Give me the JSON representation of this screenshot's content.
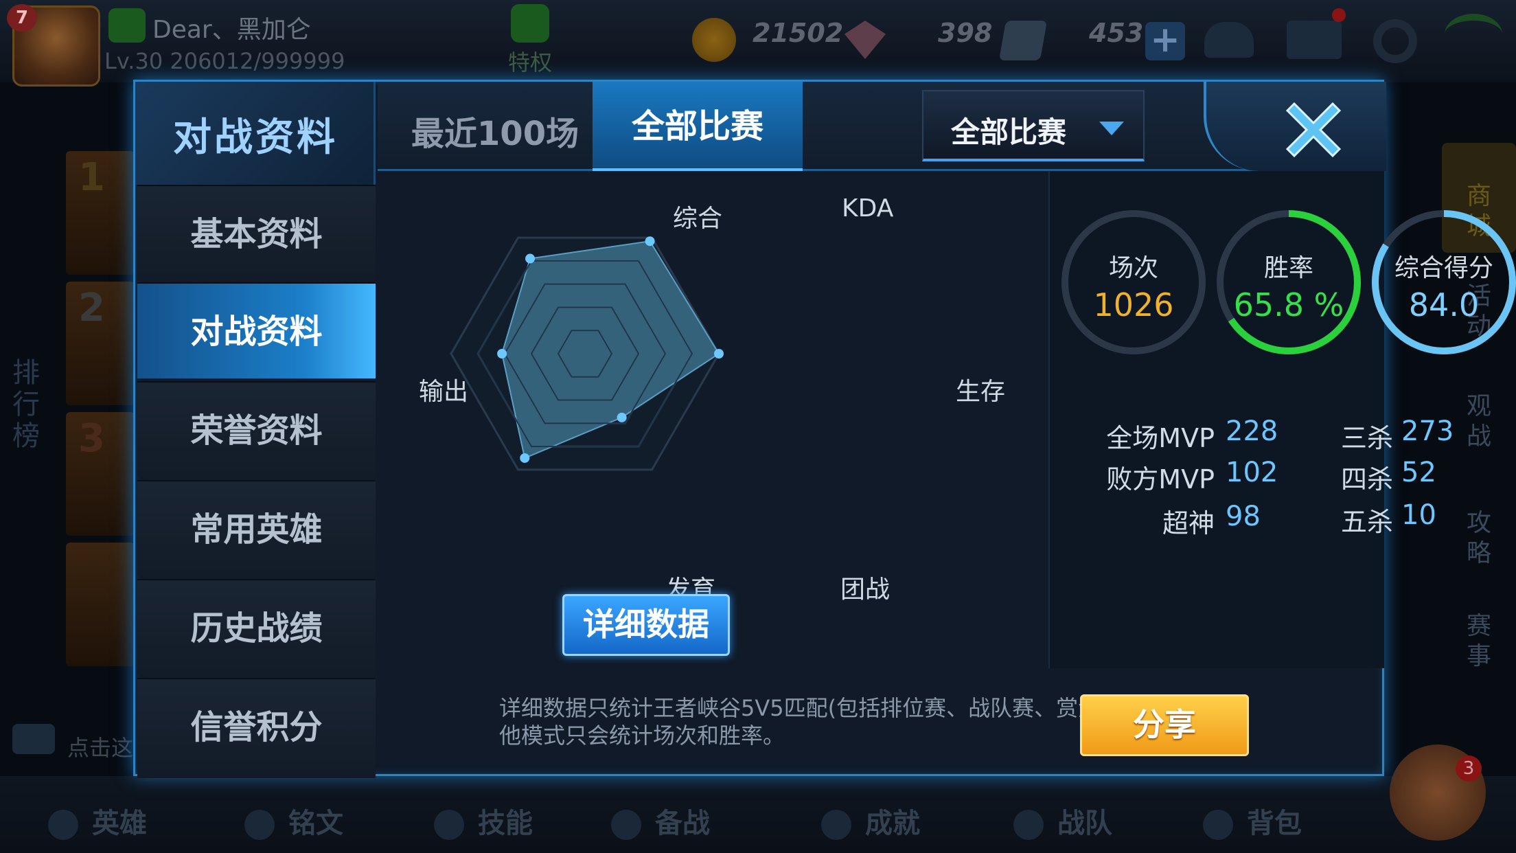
{
  "header": {
    "avatar_level": "7",
    "player_name": "Dear、黑加仑",
    "player_level": "Lv.30",
    "player_exp": "206012/999999",
    "vip_label": "特权",
    "currencies": [
      {
        "icon": "gold-coin-icon",
        "value": "21502"
      },
      {
        "icon": "diamond-icon",
        "value": "398"
      },
      {
        "icon": "voucher-icon",
        "value": "453"
      }
    ]
  },
  "left_bg": {
    "rank_numbers": [
      "1",
      "2",
      "3"
    ],
    "rank_title": "排行榜",
    "chat_hint": "点击这"
  },
  "right_bg": {
    "buttons": [
      "商城",
      "活动",
      "观战",
      "攻略",
      "赛事"
    ],
    "avatar_badge": "3"
  },
  "bottom_nav": [
    "英雄",
    "铭文",
    "技能",
    "备战",
    "成就",
    "战队",
    "背包"
  ],
  "modal": {
    "title": "对战资料",
    "tabs": [
      "最近100场",
      "全部比赛"
    ],
    "active_tab": "全部比赛",
    "dropdown": {
      "selected": "全部比赛"
    },
    "nav_items": [
      "基本资料",
      "对战资料",
      "荣誉资料",
      "常用英雄",
      "历史战绩",
      "信誉积分"
    ],
    "active_nav": "对战资料",
    "radar": {
      "labels": [
        "综合",
        "KDA",
        "生存",
        "团战",
        "发育",
        "输出"
      ],
      "values": [
        0.82,
        0.97,
        1.0,
        0.55,
        0.9,
        0.62
      ],
      "fill_color": "#3b6f8a",
      "point_color": "#6cc8ff"
    },
    "detail_button": "详细数据",
    "stats": {
      "rings": [
        {
          "label": "场次",
          "value": "1026",
          "color": "#f0b22a",
          "ring_color": "#2c3848",
          "progress": 0
        },
        {
          "label": "胜率",
          "value": "65.8 %",
          "color": "#36e04a",
          "ring_color": "#2ad13c",
          "progress": 0.658
        },
        {
          "label": "综合得分",
          "value": "84.0",
          "color": "#7fd0ff",
          "ring_color": "#6ac4f4",
          "progress": 0.84
        }
      ],
      "counts_left": [
        {
          "label": "全场MVP",
          "value": "228"
        },
        {
          "label": "败方MVP",
          "value": "102"
        },
        {
          "label": "超神",
          "value": "98"
        }
      ],
      "counts_right": [
        {
          "label": "三杀",
          "value": "273"
        },
        {
          "label": "四杀",
          "value": "52"
        },
        {
          "label": "五杀",
          "value": "10"
        }
      ]
    },
    "footer_note": "详细数据只统计王者峡谷5V5匹配(包括排位赛、战队赛、赏金赛)，其他模式只会统计场次和胜率。",
    "share_button": "分享"
  }
}
